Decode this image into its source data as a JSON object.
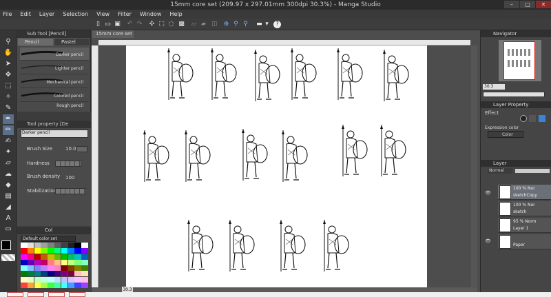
{
  "window": {
    "title": "15mm core set (209.97 x 297.01mm 300dpi 30.3%) - Manga Studio",
    "controls": [
      "–",
      "▢",
      "✕"
    ]
  },
  "menu": [
    "File",
    "Edit",
    "Layer",
    "Selection",
    "View",
    "Filter",
    "Window",
    "Help"
  ],
  "subtool": {
    "panel_title": "Sub Tool [Pencil]",
    "tabs": [
      "Pencil",
      "Pastel"
    ],
    "brushes": [
      "Darker pencil",
      "Lighter pencil",
      "Mechanical pencil",
      "Colored pencil",
      "Rough pencil"
    ]
  },
  "tool_property": {
    "panel_title": "Tool property [De",
    "preset_name": "Darker pencil",
    "brush_size_label": "Brush Size",
    "brush_size_value": "10.0",
    "hardness_label": "Hardness",
    "brush_density_label": "Brush density",
    "brush_density_value": "100",
    "stabilization_label": "Stabilization"
  },
  "color_set": {
    "tab_label": "Col",
    "set_name": "Default color set",
    "swatches": [
      "#ffffff",
      "#e0e0e0",
      "#c0c0c0",
      "#a0a0a0",
      "#808080",
      "#606060",
      "#404040",
      "#202020",
      "#000000",
      "#ffffff",
      "#ff0000",
      "#ff8000",
      "#ffff00",
      "#80ff00",
      "#00ff00",
      "#00ff80",
      "#00ffff",
      "#0080ff",
      "#0000ff",
      "#8000ff",
      "#ff00ff",
      "#ff0080",
      "#c00000",
      "#c06000",
      "#c0c000",
      "#60c000",
      "#00c000",
      "#00c060",
      "#00c0c0",
      "#0060c0",
      "#0000c0",
      "#6000c0",
      "#c000c0",
      "#c00060",
      "#ff8080",
      "#ffc080",
      "#ffff80",
      "#c0ff80",
      "#80ff80",
      "#80ffc0",
      "#80ffff",
      "#80c0ff",
      "#8080ff",
      "#c080ff",
      "#ff80ff",
      "#ff80c0",
      "#800000",
      "#804000",
      "#808000",
      "#408000",
      "#008000",
      "#008040",
      "#008080",
      "#004080",
      "#000080",
      "#400080",
      "#800080",
      "#800040",
      "#ffc0c0",
      "#ffe0c0",
      "#ffffc0",
      "#e0ffc0",
      "#c0ffc0",
      "#c0ffe0",
      "#c0ffff",
      "#c0e0ff",
      "#c0c0ff",
      "#e0c0ff",
      "#ffc0ff",
      "#ffc0e0",
      "#ff4040",
      "#ffa040",
      "#ffff40",
      "#a0ff40",
      "#40ff40",
      "#40ffa0",
      "#40ffff",
      "#40a0ff",
      "#4040ff",
      "#a040ff"
    ]
  },
  "document": {
    "tab_label": "15mm core set",
    "zoom": "30.3"
  },
  "navigator": {
    "panel_title": "Navigator",
    "zoom_value": "30.3"
  },
  "layer_property": {
    "panel_title": "Layer Property",
    "effect_label": "Effect",
    "expression_label": "Expression color",
    "expression_value": "Color"
  },
  "layers": {
    "panel_title": "Layer",
    "blend_mode": "Normal",
    "items": [
      {
        "line1": "100 %  Nor",
        "line2": "sketchCopy"
      },
      {
        "line1": "100 %  Nor",
        "line2": "sketch"
      },
      {
        "line1": "95 %  Norm",
        "line2": "Layer 1"
      },
      {
        "line1": "",
        "line2": "Paper"
      }
    ]
  },
  "colors": {
    "accent": "#5b6f8a",
    "panel_bg": "#4a4a4a",
    "nav_frame": "#dd1111"
  }
}
